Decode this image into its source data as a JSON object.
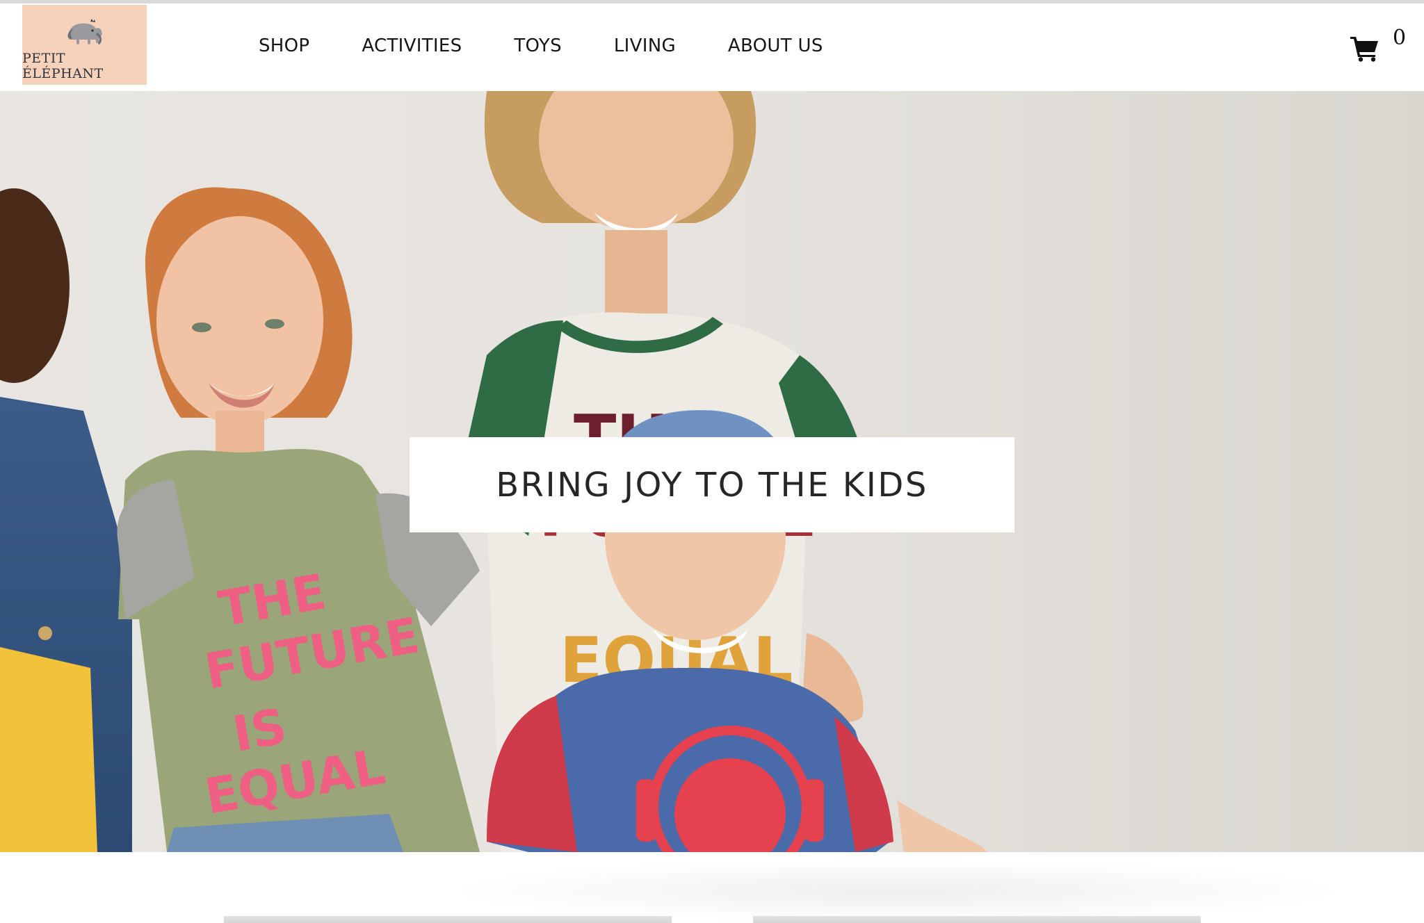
{
  "brand": {
    "name": "PETIT ÉLÉPHANT",
    "logo_icon": "elephant-icon",
    "logo_bg": "#f7d2bb"
  },
  "nav": {
    "items": [
      {
        "label": "SHOP"
      },
      {
        "label": "ACTIVITIES"
      },
      {
        "label": "TOYS"
      },
      {
        "label": "LIVING"
      },
      {
        "label": "ABOUT US"
      }
    ]
  },
  "cart": {
    "icon": "shopping-cart-icon",
    "count": "0"
  },
  "hero": {
    "headline": "BRING JOY TO THE KIDS",
    "shirt_print_green": "THE FUTURE IS EQUAL",
    "shirt_print_white": "THE FUTURE IS EQUAL"
  }
}
